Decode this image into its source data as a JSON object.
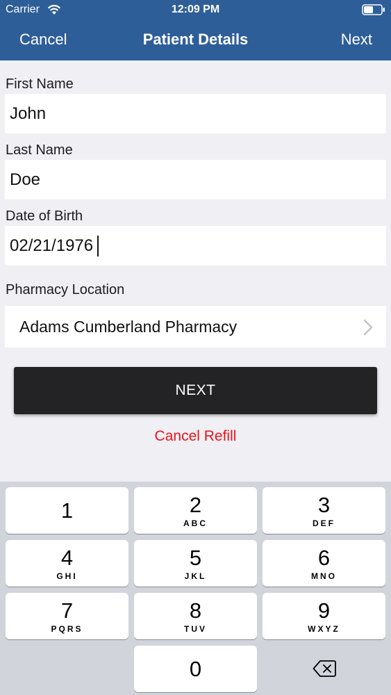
{
  "status": {
    "carrier": "Carrier",
    "time": "12:09 PM"
  },
  "nav": {
    "cancel": "Cancel",
    "title": "Patient Details",
    "next": "Next"
  },
  "form": {
    "first_name": {
      "label": "First Name",
      "value": "John"
    },
    "last_name": {
      "label": "Last Name",
      "value": "Doe"
    },
    "dob": {
      "label": "Date of Birth",
      "value": "02/21/1976"
    },
    "pharmacy": {
      "label": "Pharmacy Location",
      "value": "Adams Cumberland Pharmacy"
    }
  },
  "actions": {
    "next": "NEXT",
    "cancel_refill": "Cancel Refill"
  },
  "keypad": {
    "keys": [
      {
        "digit": "1",
        "letters": ""
      },
      {
        "digit": "2",
        "letters": "ABC"
      },
      {
        "digit": "3",
        "letters": "DEF"
      },
      {
        "digit": "4",
        "letters": "GHI"
      },
      {
        "digit": "5",
        "letters": "JKL"
      },
      {
        "digit": "6",
        "letters": "MNO"
      },
      {
        "digit": "7",
        "letters": "PQRS"
      },
      {
        "digit": "8",
        "letters": "TUV"
      },
      {
        "digit": "9",
        "letters": "WXYZ"
      },
      {
        "digit": "0",
        "letters": ""
      }
    ]
  },
  "colors": {
    "nav_bar": "#2e5e98",
    "background": "#efeff4",
    "next_button": "#232325",
    "cancel_refill": "#e8141b",
    "keypad_background": "#d1d4db"
  },
  "icons": [
    "wifi-icon",
    "battery-icon",
    "chevron-right-icon",
    "backspace-icon"
  ]
}
